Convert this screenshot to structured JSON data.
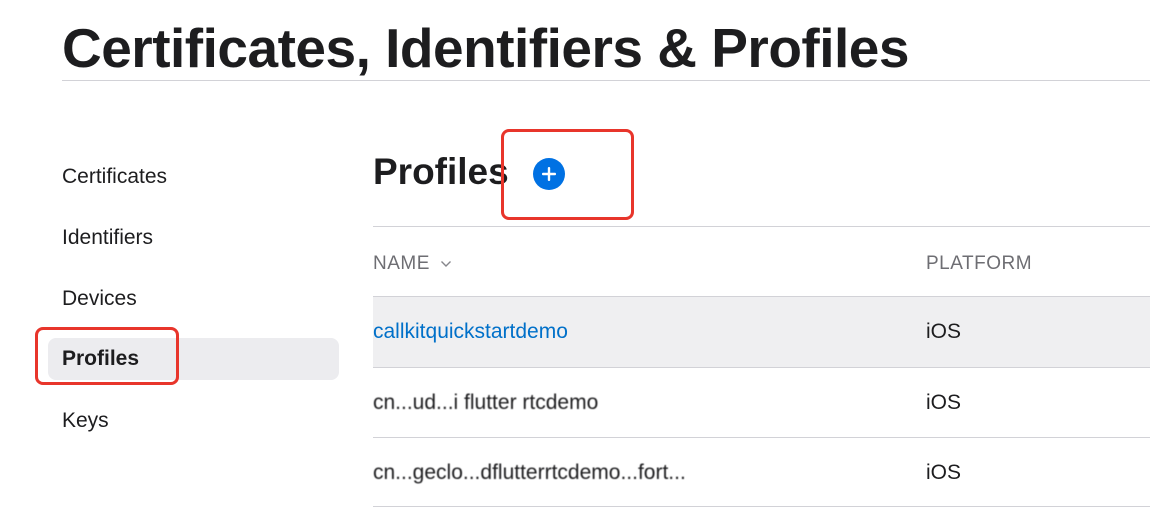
{
  "header": {
    "title": "Certificates, Identifiers & Profiles"
  },
  "sidebar": {
    "items": [
      {
        "label": "Certificates",
        "active": false
      },
      {
        "label": "Identifiers",
        "active": false
      },
      {
        "label": "Devices",
        "active": false
      },
      {
        "label": "Profiles",
        "active": true
      },
      {
        "label": "Keys",
        "active": false
      }
    ]
  },
  "main": {
    "section_title": "Profiles",
    "add_button": {
      "icon": "plus-circle-icon",
      "color": "#0071e3"
    },
    "table": {
      "columns": [
        {
          "label": "NAME",
          "sort": "chevron-down-icon"
        },
        {
          "label": "PLATFORM"
        }
      ],
      "rows": [
        {
          "name": "callkitquickstartdemo",
          "platform": "iOS",
          "selected": true,
          "link": true
        },
        {
          "name": "cn...ud...i flutter rtcdemo",
          "platform": "iOS",
          "selected": false,
          "link": false
        },
        {
          "name": "cn...geclo...dflutterrtcdemo...fort...",
          "platform": "iOS",
          "selected": false,
          "link": false
        }
      ]
    }
  },
  "annotations": {
    "highlight_color": "#e8352b"
  }
}
